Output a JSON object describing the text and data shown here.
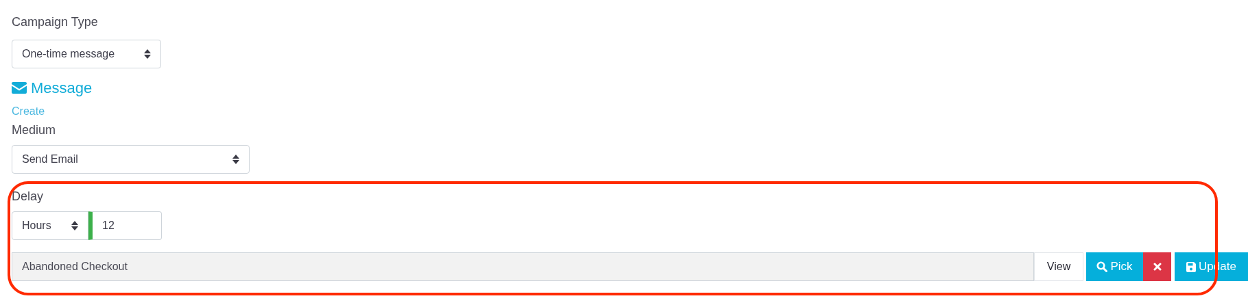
{
  "campaign_type": {
    "label": "Campaign Type",
    "value": "One-time message"
  },
  "message": {
    "title": "Message",
    "link": "Create"
  },
  "medium": {
    "label": "Medium",
    "value": "Send Email"
  },
  "delay_section": {
    "highlighted": true,
    "label": "Delay",
    "unit": "Hours",
    "value": "12",
    "valid": true,
    "template": {
      "value": "Abandoned Checkout",
      "disabled": true
    },
    "buttons": [
      {
        "kind": "view",
        "label": "View"
      },
      {
        "kind": "pick",
        "label": "Pick"
      },
      {
        "kind": "clear"
      },
      {
        "kind": "update",
        "label": "Update"
      }
    ]
  }
}
